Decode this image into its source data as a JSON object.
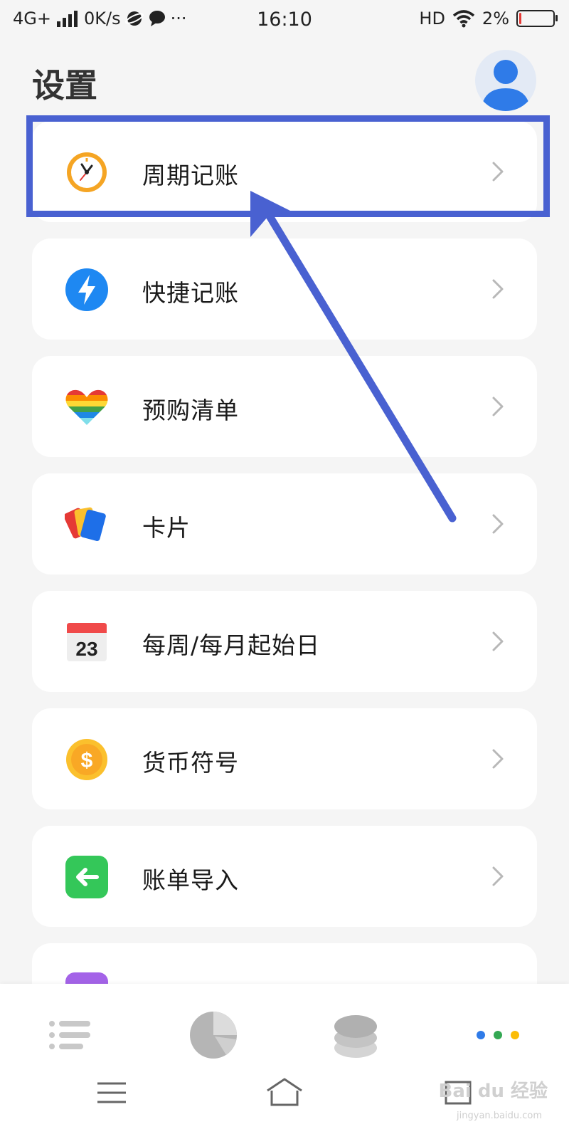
{
  "status_bar": {
    "network": "4G+",
    "speed": "0K/s",
    "more": "···",
    "time": "16:10",
    "hd": "HD",
    "battery": "2%",
    "battery_level": 0.02
  },
  "header": {
    "title": "设置",
    "avatar_icon": "user-avatar-icon"
  },
  "settings_items": [
    {
      "label": "周期记账",
      "icon": "clock-icon"
    },
    {
      "label": "快捷记账",
      "icon": "lightning-icon"
    },
    {
      "label": "预购清单",
      "icon": "rainbow-heart-icon"
    },
    {
      "label": "卡片",
      "icon": "cards-icon"
    },
    {
      "label": "每周/每月起始日",
      "icon": "calendar-icon",
      "icon_text": "23"
    },
    {
      "label": "货币符号",
      "icon": "dollar-coin-icon",
      "icon_text": "$"
    },
    {
      "label": "账单导入",
      "icon": "import-arrow-icon"
    }
  ],
  "annotation": {
    "highlight_color": "#4961d1"
  },
  "tab_bar": {
    "tabs": [
      {
        "name": "list-tab",
        "icon": "list-icon"
      },
      {
        "name": "stats-tab",
        "icon": "pie-chart-icon"
      },
      {
        "name": "assets-tab",
        "icon": "coin-stack-icon"
      },
      {
        "name": "more-tab",
        "icon": "three-dots-icon",
        "active": true
      }
    ]
  },
  "system_nav": [
    "menu-icon",
    "home-icon",
    "back-icon"
  ],
  "watermark": {
    "text": "Bai du 经验",
    "sub": "jingyan.baidu.com"
  }
}
